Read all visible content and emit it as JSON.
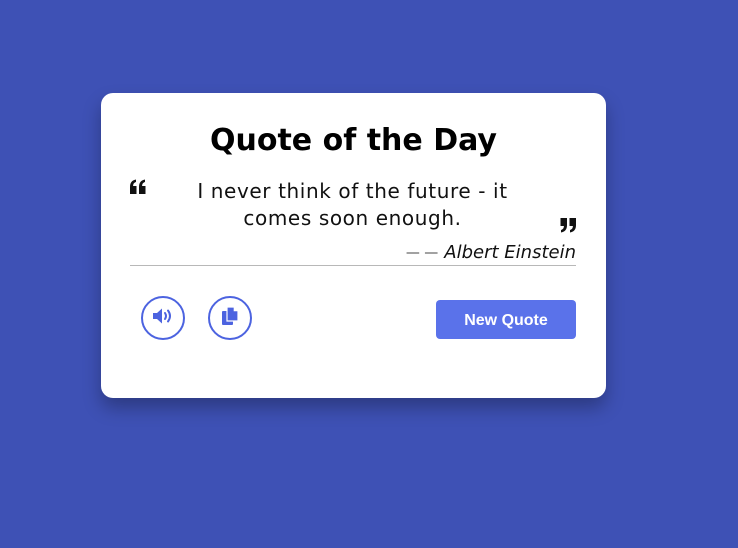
{
  "card": {
    "title": "Quote of the Day",
    "quote_text": "I never think of the future - it comes soon enough.",
    "author_dashes": "— —",
    "author": "Albert Einstein"
  },
  "actions": {
    "speak_icon": "volume-up-icon",
    "copy_icon": "copy-icon",
    "new_quote_label": "New Quote"
  },
  "colors": {
    "background": "#3e51b5",
    "accent": "#4c63e0",
    "button": "#5a72ea"
  }
}
